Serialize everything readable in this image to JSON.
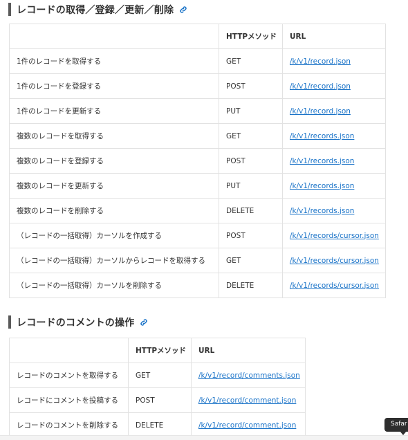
{
  "section1": {
    "title": "レコードの取得／登録／更新／削除",
    "headers": [
      "",
      "HTTPメソッド",
      "URL"
    ],
    "rows": [
      {
        "operation": "1件のレコードを取得する",
        "method": "GET",
        "url": "/k/v1/record.json"
      },
      {
        "operation": "1件のレコードを登録する",
        "method": "POST",
        "url": "/k/v1/record.json"
      },
      {
        "operation": "1件のレコードを更新する",
        "method": "PUT",
        "url": "/k/v1/record.json"
      },
      {
        "operation": "複数のレコードを取得する",
        "method": "GET",
        "url": "/k/v1/records.json"
      },
      {
        "operation": "複数のレコードを登録する",
        "method": "POST",
        "url": "/k/v1/records.json"
      },
      {
        "operation": "複数のレコードを更新する",
        "method": "PUT",
        "url": "/k/v1/records.json"
      },
      {
        "operation": "複数のレコードを削除する",
        "method": "DELETE",
        "url": "/k/v1/records.json"
      },
      {
        "operation": "（レコードの一括取得）カーソルを作成する",
        "method": "POST",
        "url": "/k/v1/records/cursor.json"
      },
      {
        "operation": "（レコードの一括取得）カーソルからレコードを取得する",
        "method": "GET",
        "url": "/k/v1/records/cursor.json"
      },
      {
        "operation": "（レコードの一括取得）カーソルを削除する",
        "method": "DELETE",
        "url": "/k/v1/records/cursor.json"
      }
    ]
  },
  "section2": {
    "title": "レコードのコメントの操作",
    "headers": [
      "",
      "HTTPメソッド",
      "URL"
    ],
    "rows": [
      {
        "operation": "レコードのコメントを取得する",
        "method": "GET",
        "url": "/k/v1/record/comments.json"
      },
      {
        "operation": "レコードにコメントを投稿する",
        "method": "POST",
        "url": "/k/v1/record/comment.json"
      },
      {
        "operation": "レコードのコメントを削除する",
        "method": "DELETE",
        "url": "/k/v1/record/comment.json"
      }
    ]
  },
  "tooltip": {
    "text": "Safar"
  },
  "icons": {
    "heading_link": "link-icon"
  },
  "colors": {
    "link": "#1a73c8",
    "heading_bar": "#5a5a5a",
    "border": "#e2e2e2"
  }
}
